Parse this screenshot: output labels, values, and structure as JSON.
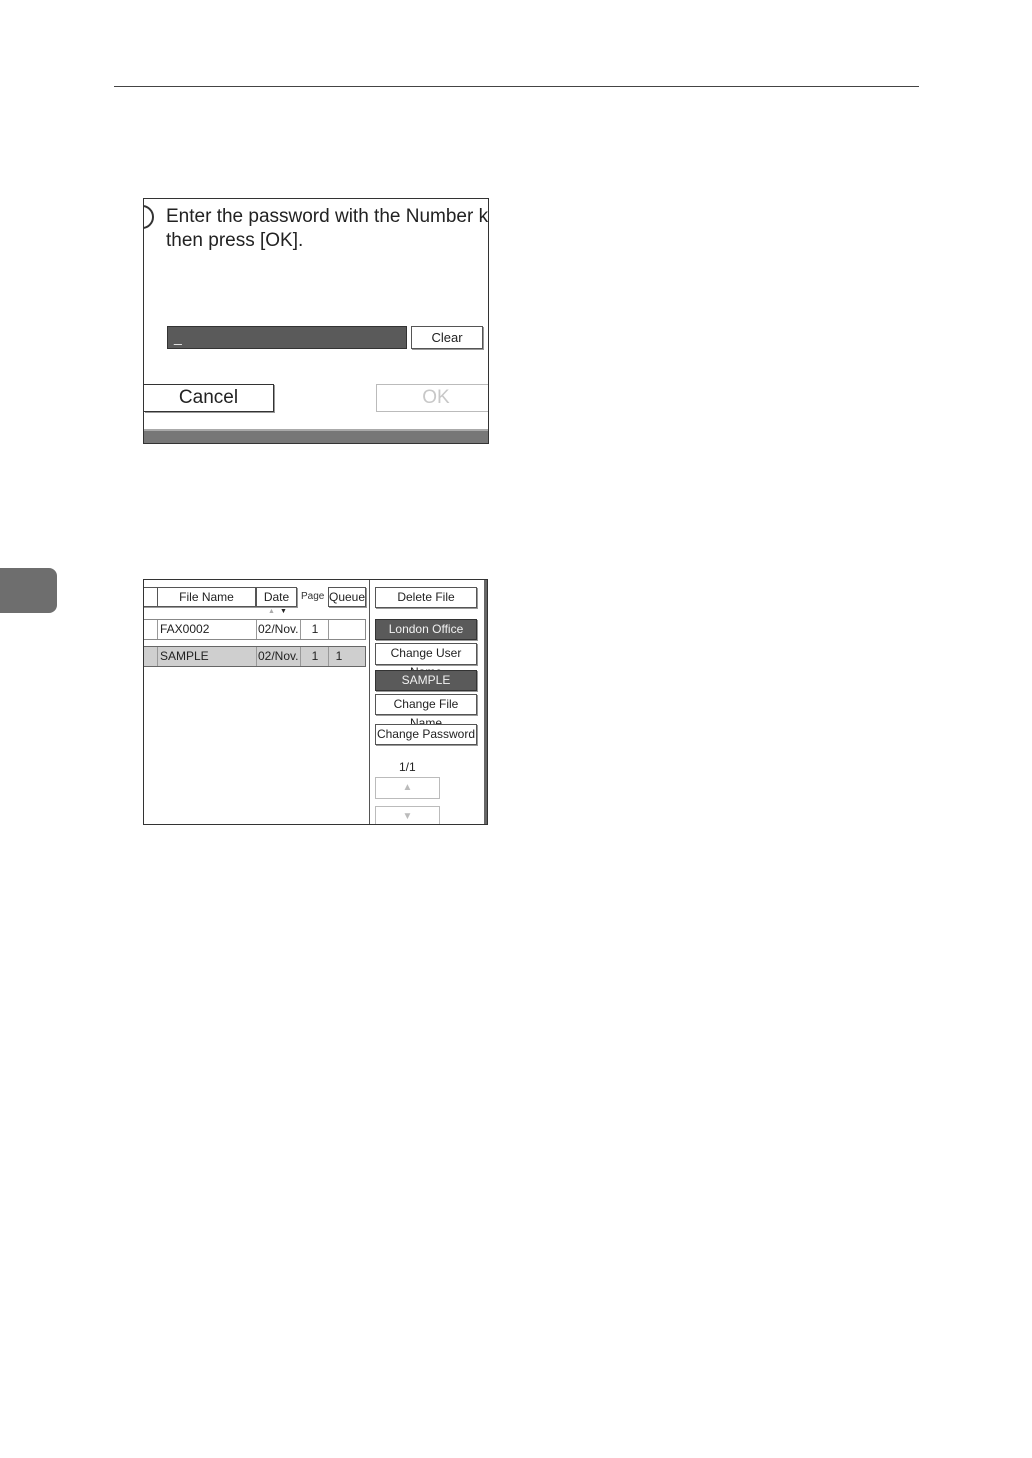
{
  "dialog": {
    "message_line1": "Enter the password with the Number key",
    "message_line2": "then press [OK].",
    "password_value": "_",
    "clear_label": "Clear",
    "cancel_label": "Cancel",
    "ok_label": "OK"
  },
  "file_list": {
    "headers": {
      "file_name": "File Name",
      "date": "Date",
      "page": "Page",
      "queue": "Queue"
    },
    "rows": [
      {
        "file_name": "FAX0002",
        "date": "02/Nov.",
        "page": "1",
        "queue": ""
      },
      {
        "file_name": "SAMPLE",
        "date": "02/Nov.",
        "page": "1",
        "queue": "1"
      }
    ],
    "side": {
      "delete_file": "Delete File",
      "user_name": "London Office",
      "change_user_name": "Change User Name",
      "file_name": "SAMPLE",
      "change_file_name": "Change File Name",
      "change_password": "Change Password",
      "page_indicator": "1/1"
    }
  }
}
